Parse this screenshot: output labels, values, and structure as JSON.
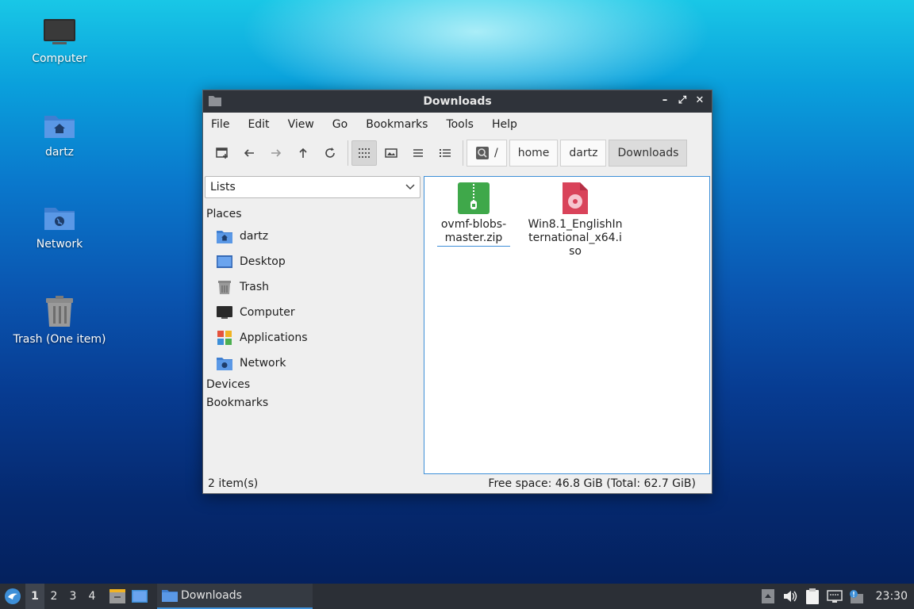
{
  "desktop": {
    "icons": [
      {
        "label": "Computer",
        "icon": "computer-icon"
      },
      {
        "label": "dartz",
        "icon": "home-folder-icon"
      },
      {
        "label": "Network",
        "icon": "network-folder-icon"
      },
      {
        "label": "Trash (One item)",
        "icon": "trash-icon"
      }
    ]
  },
  "window": {
    "title": "Downloads",
    "controls": {
      "minimize": "–",
      "maximize": "⤢",
      "close": "✕"
    },
    "menu": [
      "File",
      "Edit",
      "View",
      "Go",
      "Bookmarks",
      "Tools",
      "Help"
    ],
    "path": {
      "root": "/",
      "segments": [
        "home",
        "dartz",
        "Downloads"
      ]
    },
    "side": {
      "mode": "Lists",
      "places_header": "Places",
      "places": [
        {
          "label": "dartz",
          "icon": "home-folder-icon"
        },
        {
          "label": "Desktop",
          "icon": "desktop-icon"
        },
        {
          "label": "Trash",
          "icon": "trash-icon"
        },
        {
          "label": "Computer",
          "icon": "computer-icon"
        },
        {
          "label": "Applications",
          "icon": "applications-icon"
        },
        {
          "label": "Network",
          "icon": "network-folder-icon"
        }
      ],
      "devices_header": "Devices",
      "bookmarks_header": "Bookmarks"
    },
    "files": [
      {
        "name": "ovmf-blobs-master.zip",
        "icon": "zip-archive-icon"
      },
      {
        "name": "Win8.1_EnglishInternational_x64.iso",
        "icon": "disc-image-icon"
      }
    ],
    "status": {
      "count": "2 item(s)",
      "space": "Free space: 46.8 GiB (Total: 62.7 GiB)"
    }
  },
  "taskbar": {
    "workspaces": [
      "1",
      "2",
      "3",
      "4"
    ],
    "active_workspace": "1",
    "task_label": "Downloads",
    "clock": "23:30"
  }
}
